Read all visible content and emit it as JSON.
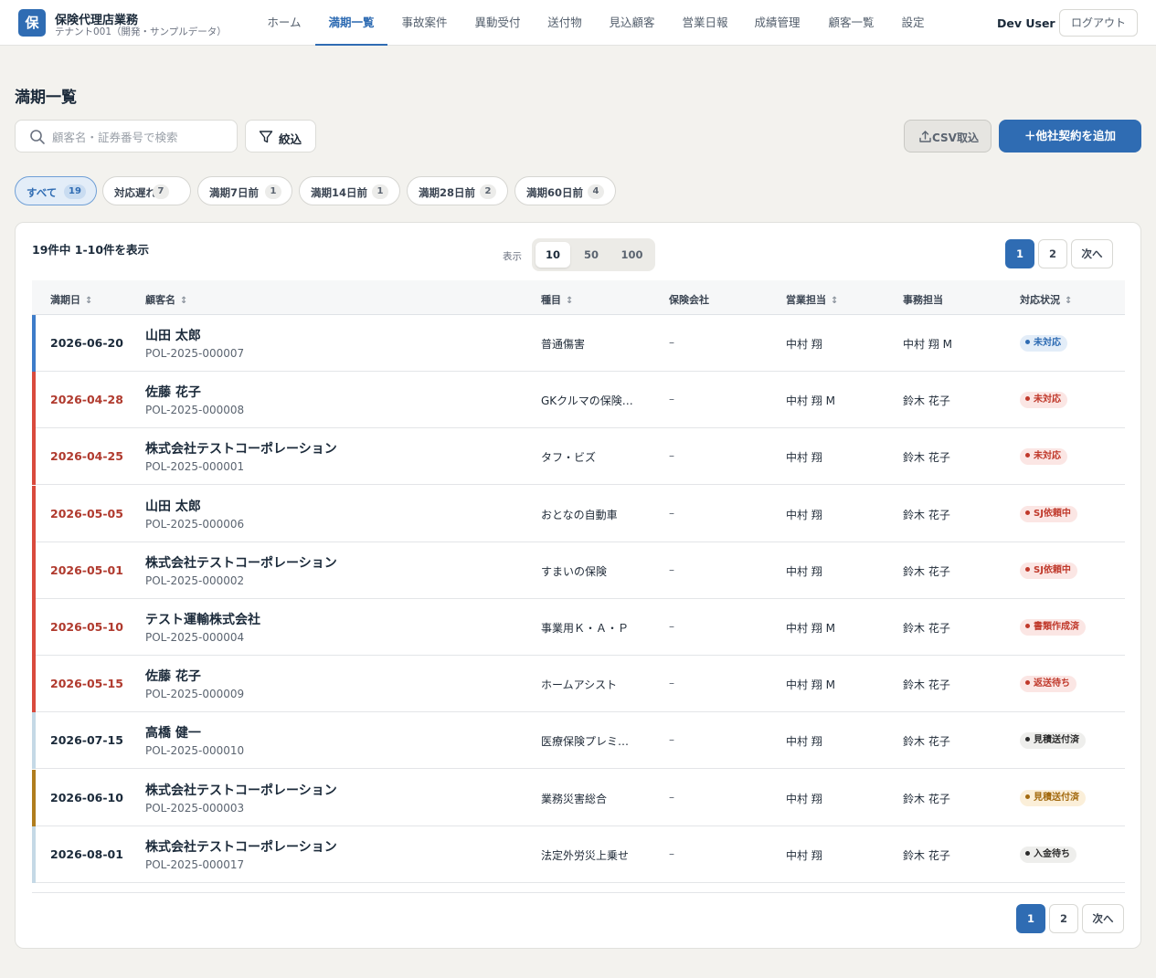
{
  "header": {
    "logo_char": "保",
    "app_title": "保険代理店業務",
    "tenant": "テナント001（開発・サンプルデータ）",
    "nav": [
      "ホーム",
      "満期一覧",
      "事故案件",
      "異動受付",
      "送付物",
      "見込顧客",
      "営業日報",
      "成績管理",
      "顧客一覧",
      "設定"
    ],
    "active_nav": "満期一覧",
    "user_name": "Dev User",
    "logout_label": "ログアウト"
  },
  "page": {
    "title": "満期一覧"
  },
  "toolbar": {
    "search_placeholder": "顧客名・証券番号で検索",
    "search_value": "",
    "filter_label": "絞込",
    "csv_label": "CSV取込",
    "add_label": "＋他社契約を追加"
  },
  "chips": [
    {
      "label": "すべて",
      "count": "19",
      "active": true
    },
    {
      "label": "対応遅れ",
      "count": "7",
      "active": false
    },
    {
      "label": "満期7日前",
      "count": "1",
      "active": false
    },
    {
      "label": "満期14日前",
      "count": "1",
      "active": false
    },
    {
      "label": "満期28日前",
      "count": "2",
      "active": false
    },
    {
      "label": "満期60日前",
      "count": "4",
      "active": false
    }
  ],
  "list": {
    "summary": "19件中 1-10件を表示",
    "per_page_label": "表示",
    "per_page_options": [
      "10",
      "50",
      "100"
    ],
    "per_page_selected": "10",
    "pagination": {
      "pages": [
        "1",
        "2"
      ],
      "current": "1",
      "next_label": "次へ"
    },
    "columns": [
      {
        "label": "満期日",
        "sortable": true
      },
      {
        "label": "顧客名",
        "sortable": true
      },
      {
        "label": "種目",
        "sortable": true
      },
      {
        "label": "保険会社",
        "sortable": false
      },
      {
        "label": "営業担当",
        "sortable": true
      },
      {
        "label": "事務担当",
        "sortable": false
      },
      {
        "label": "対応状況",
        "sortable": true
      }
    ],
    "sort_icon": "↕",
    "rows": [
      {
        "date": "2026-06-20",
        "overdue": false,
        "name": "山田 太郎",
        "policy": "POL-2025-000007",
        "type": "普通傷害",
        "insurer": "–",
        "sales": "中村 翔",
        "office": "中村 翔 M",
        "status": "未対応",
        "status_tone": "blue",
        "bar": "blue"
      },
      {
        "date": "2026-04-28",
        "overdue": true,
        "name": "佐藤 花子",
        "policy": "POL-2025-000008",
        "type": "GKクルマの保険…",
        "insurer": "–",
        "sales": "中村 翔 M",
        "office": "鈴木 花子",
        "status": "未対応",
        "status_tone": "red",
        "bar": "red"
      },
      {
        "date": "2026-04-25",
        "overdue": true,
        "name": "株式会社テストコーポレーション",
        "policy": "POL-2025-000001",
        "type": "タフ・ビズ",
        "insurer": "–",
        "sales": "中村 翔",
        "office": "鈴木 花子",
        "status": "未対応",
        "status_tone": "red",
        "bar": "red"
      },
      {
        "date": "2026-05-05",
        "overdue": true,
        "name": "山田 太郎",
        "policy": "POL-2025-000006",
        "type": "おとなの自動車",
        "insurer": "–",
        "sales": "中村 翔",
        "office": "鈴木 花子",
        "status": "SJ依頼中",
        "status_tone": "red",
        "bar": "red"
      },
      {
        "date": "2026-05-01",
        "overdue": true,
        "name": "株式会社テストコーポレーション",
        "policy": "POL-2025-000002",
        "type": "すまいの保険",
        "insurer": "–",
        "sales": "中村 翔",
        "office": "鈴木 花子",
        "status": "SJ依頼中",
        "status_tone": "red",
        "bar": "red"
      },
      {
        "date": "2026-05-10",
        "overdue": true,
        "name": "テスト運輸株式会社",
        "policy": "POL-2025-000004",
        "type": "事業用Ｋ・Ａ・Ｐ",
        "insurer": "–",
        "sales": "中村 翔 M",
        "office": "鈴木 花子",
        "status": "書類作成済",
        "status_tone": "red",
        "bar": "red"
      },
      {
        "date": "2026-05-15",
        "overdue": true,
        "name": "佐藤 花子",
        "policy": "POL-2025-000009",
        "type": "ホームアシスト",
        "insurer": "–",
        "sales": "中村 翔 M",
        "office": "鈴木 花子",
        "status": "返送待ち",
        "status_tone": "red",
        "bar": "red"
      },
      {
        "date": "2026-07-15",
        "overdue": false,
        "name": "高橋 健一",
        "policy": "POL-2025-000010",
        "type": "医療保険プレミ…",
        "insurer": "–",
        "sales": "中村 翔",
        "office": "鈴木 花子",
        "status": "見積送付済",
        "status_tone": "gray",
        "bar": "lightblue"
      },
      {
        "date": "2026-06-10",
        "overdue": false,
        "name": "株式会社テストコーポレーション",
        "policy": "POL-2025-000003",
        "type": "業務災害総合",
        "insurer": "–",
        "sales": "中村 翔",
        "office": "鈴木 花子",
        "status": "見積送付済",
        "status_tone": "amber",
        "bar": "amber"
      },
      {
        "date": "2026-08-01",
        "overdue": false,
        "name": "株式会社テストコーポレーション",
        "policy": "POL-2025-000017",
        "type": "法定外労災上乗せ",
        "insurer": "–",
        "sales": "中村 翔",
        "office": "鈴木 花子",
        "status": "入金待ち",
        "status_tone": "gray",
        "bar": "lightblue"
      }
    ]
  },
  "colors": {
    "accent": "#2f6cb3",
    "overdue_text": "#b03a2e",
    "bar_blue": "#3d7cc9",
    "bar_red": "#d94a3d",
    "bar_lightblue": "#c5d9e6",
    "bar_amber": "#b07d1e",
    "badge_blue_bg": "#e3edf8",
    "badge_blue_fg": "#2f6cb3",
    "badge_red_bg": "#fbe6e4",
    "badge_red_fg": "#c0392b",
    "badge_gray_bg": "#eeeeec",
    "badge_gray_fg": "#2b2b2b",
    "badge_amber_bg": "#fbefd9",
    "badge_amber_fg": "#a36a0f"
  },
  "icons": {
    "search": "search-icon",
    "filter": "filter-icon",
    "csv": "upload-icon"
  }
}
